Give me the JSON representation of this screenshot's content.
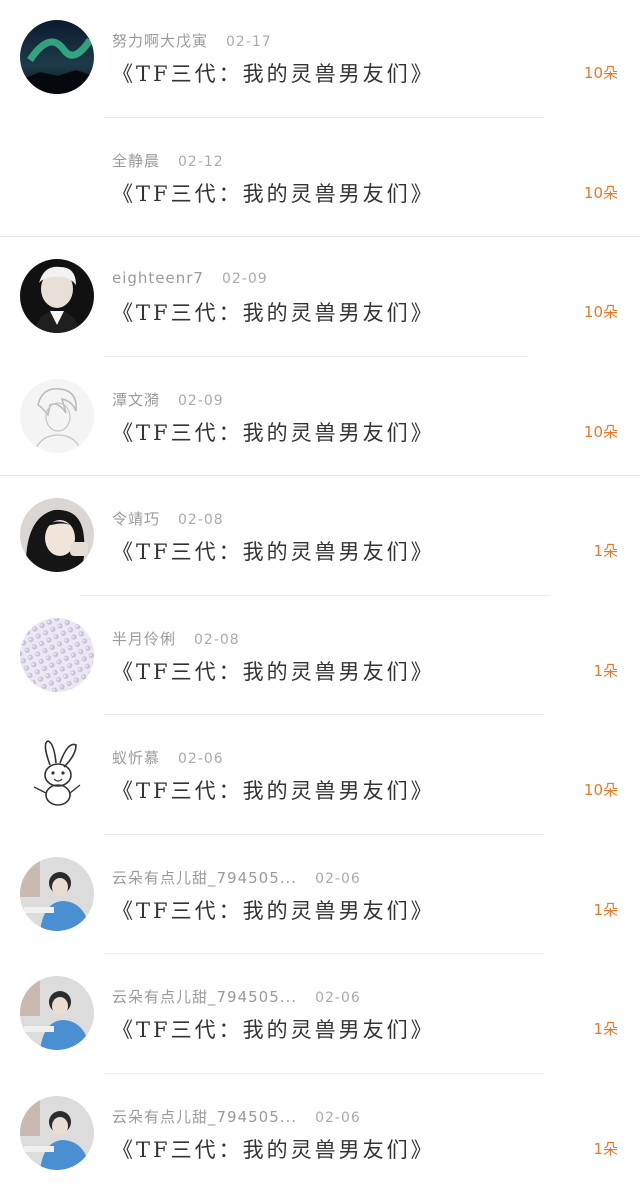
{
  "comments": [
    {
      "user": "努力啊大戊寅",
      "date": "02-17",
      "title": "《TF三代：我的灵兽男友们》",
      "count": "10朵"
    },
    {
      "user": "全静晨",
      "date": "02-12",
      "title": "《TF三代：我的灵兽男友们》",
      "count": "10朵"
    },
    {
      "user": "eighteenr7",
      "date": "02-09",
      "title": "《TF三代：我的灵兽男友们》",
      "count": "10朵"
    },
    {
      "user": "潭文漪",
      "date": "02-09",
      "title": "《TF三代：我的灵兽男友们》",
      "count": "10朵"
    },
    {
      "user": "令靖巧",
      "date": "02-08",
      "title": "《TF三代：我的灵兽男友们》",
      "count": "1朵"
    },
    {
      "user": "半月伶俐",
      "date": "02-08",
      "title": "《TF三代：我的灵兽男友们》",
      "count": "1朵"
    },
    {
      "user": "蚁忻慕",
      "date": "02-06",
      "title": "《TF三代：我的灵兽男友们》",
      "count": "10朵"
    },
    {
      "user": "云朵有点儿甜_794505...",
      "date": "02-06",
      "title": "《TF三代：我的灵兽男友们》",
      "count": "1朵"
    },
    {
      "user": "云朵有点儿甜_794505...",
      "date": "02-06",
      "title": "《TF三代：我的灵兽男友们》",
      "count": "1朵"
    },
    {
      "user": "云朵有点儿甜_794505...",
      "date": "02-06",
      "title": "《TF三代：我的灵兽男友们》",
      "count": "1朵"
    }
  ],
  "colors": {
    "accent": "#e4792a",
    "meta": "#9a9a9a",
    "title": "#333333",
    "divider": "#ececec"
  }
}
